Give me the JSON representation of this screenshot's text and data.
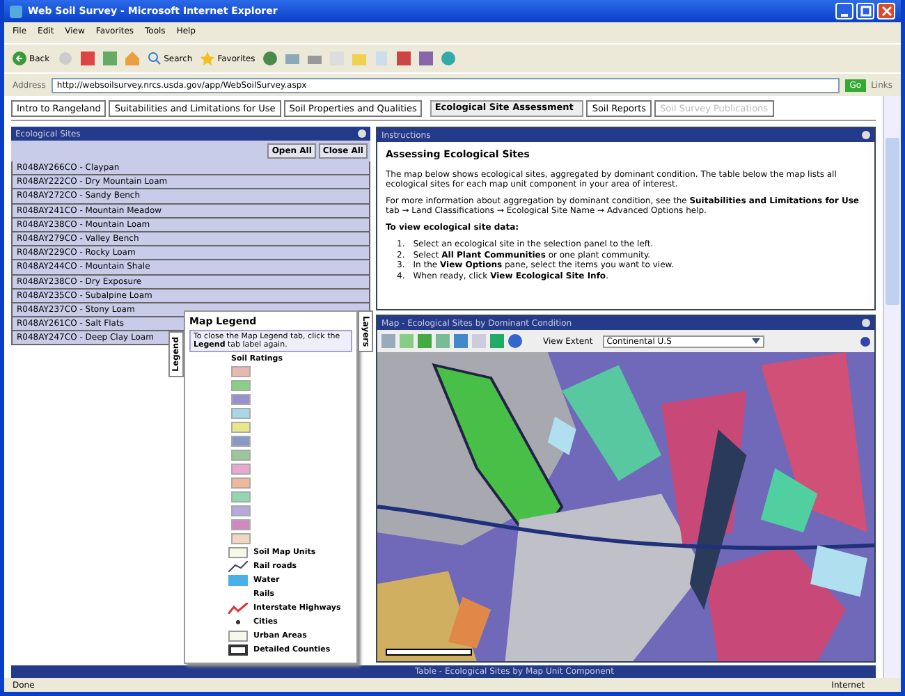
{
  "window": {
    "title": "Web Soil Survey - Microsoft Internet Explorer"
  },
  "menu": [
    "File",
    "Edit",
    "View",
    "Favorites",
    "Tools",
    "Help"
  ],
  "toolbar": {
    "back": "Back",
    "search": "Search",
    "favorites": "Favorites"
  },
  "address": {
    "label": "Address",
    "url": "http://websoilsurvey.nrcs.usda.gov/app/WebSoilSurvey.aspx",
    "go": "Go",
    "links": "Links"
  },
  "tabs": [
    {
      "label": "Intro to Rangeland",
      "selected": false,
      "disabled": false
    },
    {
      "label": "Suitabilities and Limitations for Use",
      "selected": false,
      "disabled": false
    },
    {
      "label": "Soil Properties and Qualities",
      "selected": false,
      "disabled": false
    },
    {
      "label": "Ecological Site Assessment",
      "selected": true,
      "disabled": false
    },
    {
      "label": "Soil Reports",
      "selected": false,
      "disabled": false
    },
    {
      "label": "Soil Survey Publications",
      "selected": false,
      "disabled": true
    }
  ],
  "sites_panel": {
    "title": "Ecological Sites",
    "open_all": "Open All",
    "close_all": "Close All",
    "items": [
      "R048AY266CO - Claypan",
      "R048AY222CO - Dry Mountain Loam",
      "R048AY272CO - Sandy Bench",
      "R048AY241CO - Mountain Meadow",
      "R048AY238CO - Mountain Loam",
      "R048AY279CO - Valley Bench",
      "R048AY229CO - Rocky Loam",
      "R048AY244CO - Mountain Shale",
      "R048AY238CO - Dry Exposure",
      "R048AY235CO - Subalpine Loam",
      "R048AY237CO - Stony Loam",
      "R048AY261CO - Salt Flats",
      "R048AY247CO - Deep Clay Loam"
    ]
  },
  "instructions": {
    "title": "Instructions",
    "heading": "Assessing Ecological Sites",
    "paragraphs": [
      "The map below shows ecological sites, aggregated by dominant condition. The table below the map lists all ecological sites for each map unit component in your area of interest.",
      "For more information about aggregation by dominant condition, see the **Suitabilities and Limitations for Use** tab → Land Classifications → Ecological Site Name → Advanced Options help."
    ],
    "subheading": "To view ecological site data:",
    "steps": [
      {
        "number": "1.",
        "text": "Select an ecological site in the selection panel to the left."
      },
      {
        "number": "2.",
        "text": "Select **All Plant Communities** or one plant community."
      },
      {
        "number": "3.",
        "text": "In the **View Options** pane, select the items you want to view."
      },
      {
        "number": "4.",
        "text": "When ready, click **View Ecological Site Info**."
      }
    ]
  },
  "map": {
    "title": "Map - Ecological Sites by Dominant Condition",
    "extent_label": "View Extent",
    "extent_value": "Continental U.S"
  },
  "legend": {
    "tab": "Legend",
    "layers_tab": "Layers",
    "title": "Map Legend",
    "note": "To close the Map Legend tab, click the **Legend** tab label again.",
    "ratings_title": "Soil Ratings",
    "swatches": [
      {
        "color": "#e8b8b0"
      },
      {
        "color": "#88d088"
      },
      {
        "color": "#9890d0"
      },
      {
        "color": "#a8d8e8"
      },
      {
        "color": "#e8e888"
      },
      {
        "color": "#8898c8"
      },
      {
        "color": "#98c898"
      },
      {
        "color": "#e8a8d0"
      },
      {
        "color": "#f0b898"
      },
      {
        "color": "#90d8b0"
      },
      {
        "color": "#b8a8e0"
      },
      {
        "color": "#d088c0"
      },
      {
        "color": "#f0d8c0"
      }
    ],
    "layers": [
      {
        "kind": "box",
        "label": "Soil Map Units"
      },
      {
        "kind": "line",
        "label": "Rail roads"
      },
      {
        "kind": "water",
        "label": "Water"
      },
      {
        "kind": "text",
        "label": "Rails"
      },
      {
        "kind": "highway",
        "label": "Interstate Highways"
      },
      {
        "kind": "dot",
        "label": "Cities"
      },
      {
        "kind": "box",
        "label": "Urban Areas"
      },
      {
        "kind": "thick",
        "label": "Detailed Counties"
      }
    ]
  },
  "table_bar": {
    "title": "Table - Ecological Sites by Map Unit Component"
  },
  "status_bar": {
    "status": "Done",
    "zone": "Internet"
  }
}
